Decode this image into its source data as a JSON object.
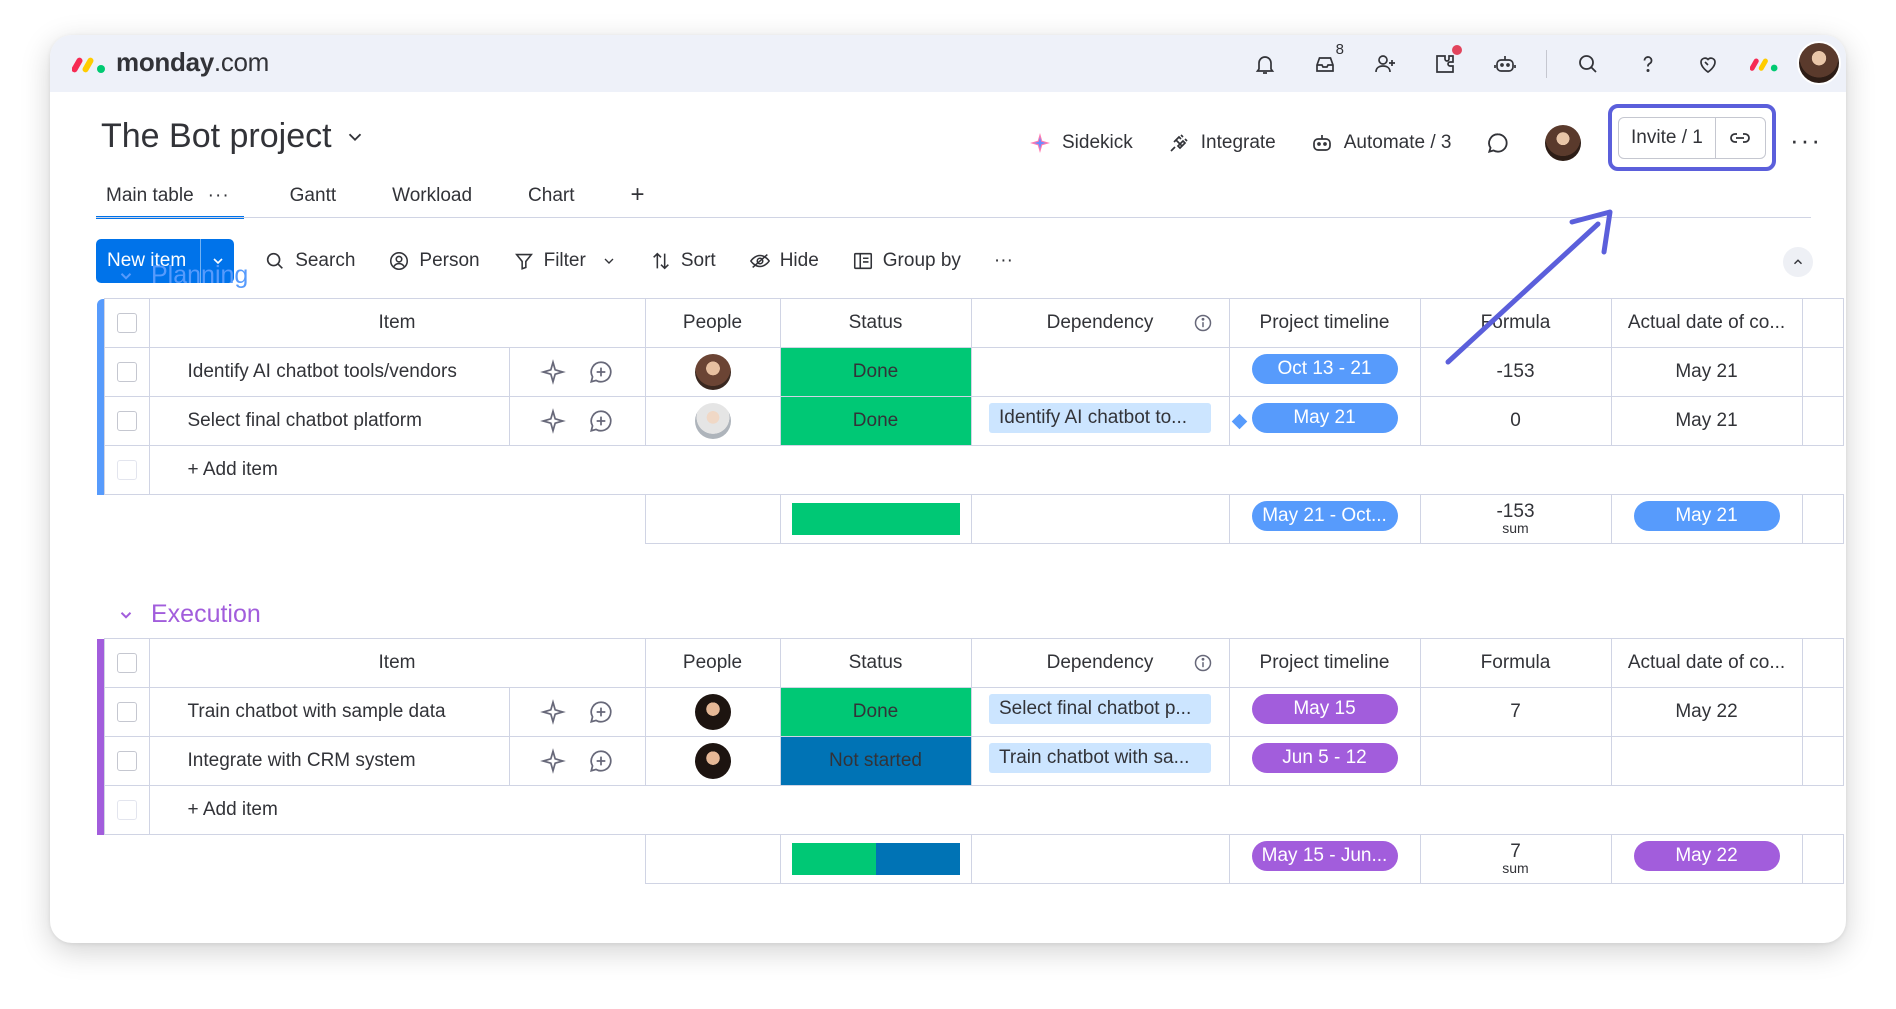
{
  "app": {
    "brand_bold": "monday",
    "brand_rest": ".com"
  },
  "top_icons": [
    {
      "name": "bell-icon"
    },
    {
      "name": "inbox-icon",
      "badge": "8"
    },
    {
      "name": "invite-members-icon"
    },
    {
      "name": "apps-icon",
      "dot": true
    },
    {
      "name": "ai-robot-icon"
    },
    {
      "name": "search-icon"
    },
    {
      "name": "help-icon"
    },
    {
      "name": "heart-icon"
    }
  ],
  "board": {
    "title": "The Bot project",
    "actions": {
      "sidekick": "Sidekick",
      "integrate": "Integrate",
      "automate": "Automate / 3",
      "invite": "Invite / 1"
    },
    "tabs": [
      "Main table",
      "Gantt",
      "Workload",
      "Chart"
    ],
    "more_dots": "···"
  },
  "toolbar": {
    "new_item": "New item",
    "search": "Search",
    "person": "Person",
    "filter": "Filter",
    "sort": "Sort",
    "hide": "Hide",
    "group_by": "Group by"
  },
  "columns": [
    "Item",
    "People",
    "Status",
    "Dependency",
    "Project timeline",
    "Formula",
    "Actual date of co..."
  ],
  "add_item": "+ Add item",
  "sum_label": "sum",
  "colors": {
    "planning": "#579bfc",
    "execution": "#a25ddc",
    "done": "#00c875",
    "not_started": "#0073b5",
    "accent": "#0073ea"
  },
  "groups": [
    {
      "name": "Planning",
      "rows": [
        {
          "item": "Identify AI chatbot tools/vendors",
          "status": "Done",
          "dependency": "",
          "timeline": "Oct 13 - 21",
          "formula": "-153",
          "actual": "May 21"
        },
        {
          "item": "Select final chatbot platform",
          "status": "Done",
          "dependency": "Identify AI chatbot to...",
          "timeline": "May 21",
          "formula": "0",
          "actual": "May 21"
        }
      ],
      "summary": {
        "timeline": "May 21 - Oct...",
        "formula": "-153",
        "actual": "May 21"
      }
    },
    {
      "name": "Execution",
      "rows": [
        {
          "item": "Train chatbot with sample data",
          "status": "Done",
          "dependency": "Select final chatbot p...",
          "timeline": "May 15",
          "formula": "7",
          "actual": "May 22"
        },
        {
          "item": "Integrate with CRM system",
          "status": "Not started",
          "dependency": "Train chatbot with sa...",
          "timeline": "Jun 5 - 12",
          "formula": "",
          "actual": ""
        }
      ],
      "summary": {
        "timeline": "May 15 - Jun...",
        "formula": "7",
        "actual": "May 22",
        "status_split": [
          0.5,
          0.5
        ]
      }
    }
  ]
}
